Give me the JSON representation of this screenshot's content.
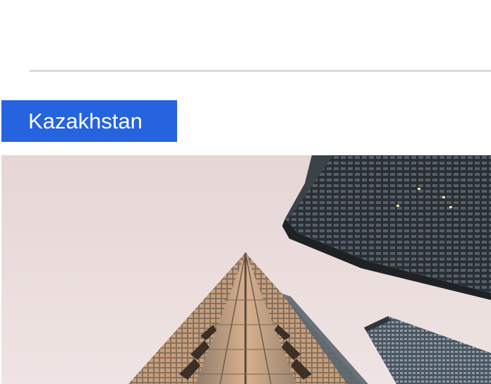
{
  "section": {
    "country_label": "Kazakhstan"
  },
  "colors": {
    "tag_background": "#2563df",
    "tag_text": "#ffffff",
    "divider": "#d9d9d9",
    "sky": "#e9dcdc"
  },
  "hero_image": {
    "icon": "skyscrapers-photo"
  }
}
